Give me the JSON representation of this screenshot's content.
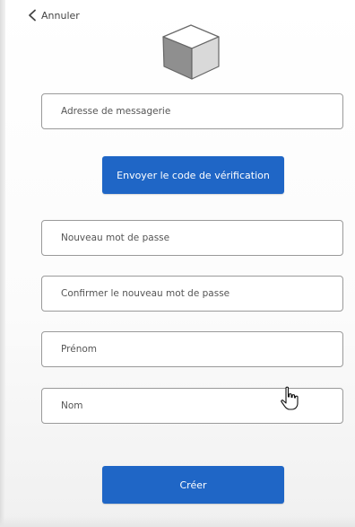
{
  "header": {
    "back_label": "Annuler"
  },
  "form": {
    "email_placeholder": "Adresse de messagerie",
    "send_code_label": "Envoyer le code de vérification",
    "new_password_placeholder": "Nouveau mot de passe",
    "confirm_password_placeholder": "Confirmer le nouveau mot de passe",
    "first_name_placeholder": "Prénom",
    "last_name_placeholder": "Nom",
    "create_label": "Créer"
  },
  "colors": {
    "accent": "#1f66c6",
    "border": "#9a9a9a"
  },
  "icons": {
    "back": "chevron-left-icon",
    "logo": "cube-logo-icon",
    "cursor": "hand-pointer-icon"
  }
}
